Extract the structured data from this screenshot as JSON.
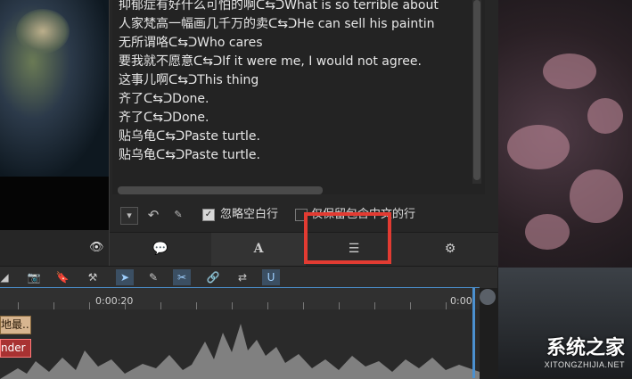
{
  "subtitle_lines": [
    "抑郁症有好什么可怕的啊ᑕ⇆ᑐWhat is so terrible about",
    "人家梵高一幅画几千万的卖ᑕ⇆ᑐHe can sell his paintin",
    "无所谓咯ᑕ⇆ᑐWho cares",
    "要我就不愿意ᑕ⇆ᑐIf it were me, I would not agree.",
    "这事儿啊ᑕ⇆ᑐThis thing",
    "齐了ᑕ⇆ᑐDone.",
    "齐了ᑕ⇆ᑐDone.",
    "贴乌龟ᑕ⇆ᑐPaste turtle.",
    "贴乌龟ᑕ⇆ᑐPaste turtle."
  ],
  "options": {
    "ignore_blank_label": "忽略空白行",
    "ignore_blank_checked": "✓",
    "keep_lines_label": "仅保留包含中文的行"
  },
  "tabs": [
    {
      "name": "subtitle-tab",
      "glyph": "💬"
    },
    {
      "name": "font-tab",
      "glyph": "A"
    },
    {
      "name": "list-tab",
      "glyph": "☰"
    },
    {
      "name": "settings-tab",
      "glyph": "⚙"
    }
  ],
  "timeline": {
    "timecode_1": "0:00:20",
    "timecode_2": "0:00",
    "clip1_label": "地最..",
    "clip2_label": "nder"
  },
  "watermark": {
    "main": "系统之家",
    "sub": "XITONGZHIJIA.NET"
  },
  "colors": {
    "highlight": "#e23b32",
    "accent_blue": "#4b90cf"
  }
}
